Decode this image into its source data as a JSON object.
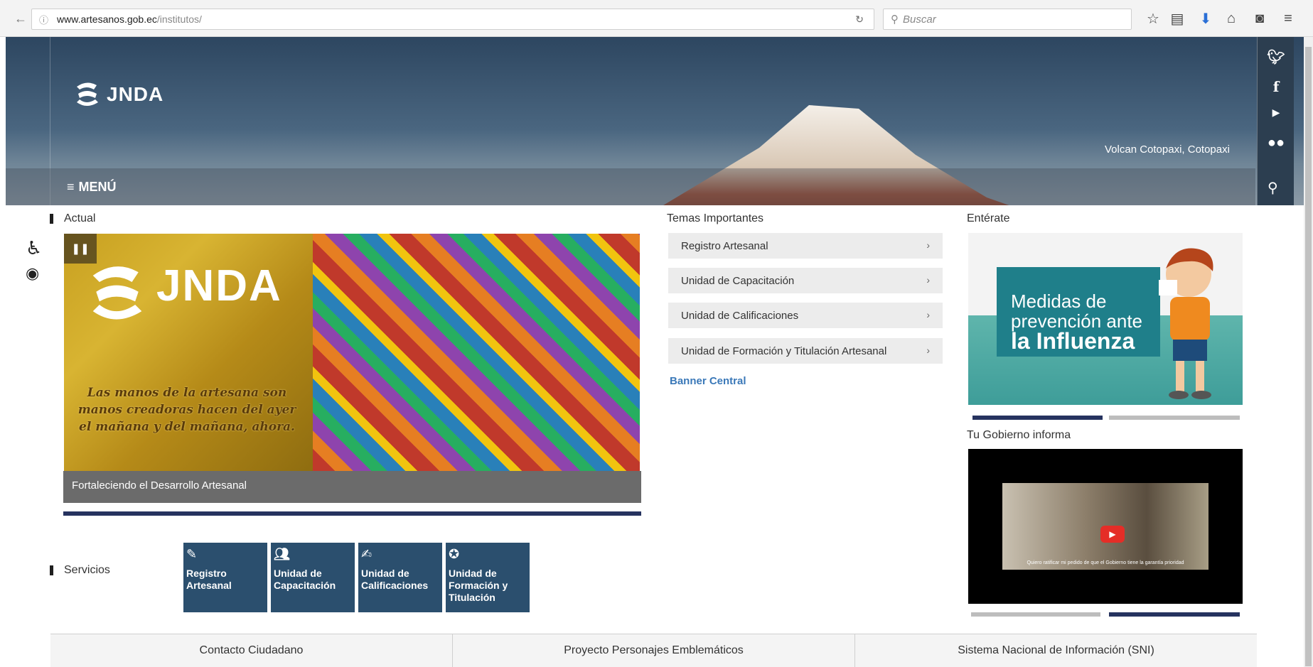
{
  "browser": {
    "url_domain": "www.artesanos.gob.ec",
    "url_path": "/institutos/",
    "search_placeholder": "Buscar"
  },
  "header": {
    "logo_text": "JNDA",
    "photo_caption": "Volcan Cotopaxi, Cotopaxi",
    "menu_label": "MENÚ"
  },
  "social": [
    "twitter-icon",
    "facebook-icon",
    "youtube-icon",
    "flickr-icon"
  ],
  "actual": {
    "title": "Actual",
    "slide_logo": "JNDA",
    "slide_motto": "Las manos de la artesana son manos creadoras hacen del ayer el mañana y del mañana, ahora.",
    "caption": "Fortaleciendo el Desarrollo Artesanal"
  },
  "servicios": {
    "title": "Servicios",
    "items": [
      {
        "label": "Registro Artesanal",
        "icon": "pencil-icon"
      },
      {
        "label": "Unidad de Capacitación",
        "icon": "users-icon"
      },
      {
        "label": "Unidad de Calificaciones",
        "icon": "edit-icon"
      },
      {
        "label": "Unidad de Formación y Titulación",
        "icon": "award-icon"
      }
    ]
  },
  "temas": {
    "title": "Temas Importantes",
    "items": [
      "Registro Artesanal",
      "Unidad de Capacitación",
      "Unidad de Calificaciones",
      "Unidad de Formación y Titulación Artesanal"
    ],
    "banner_link": "Banner Central"
  },
  "enterate": {
    "title": "Entérate",
    "line1": "Medidas de",
    "line2": "prevención ante",
    "line3": "la Influenza"
  },
  "gobierno": {
    "title": "Tu Gobierno informa",
    "video_subtitle": "Quiero ratificar mi pedido de que el Gobierno tiene la garantía prioridad"
  },
  "footer": [
    "Contacto Ciudadano",
    "Proyecto Personajes Emblemáticos",
    "Sistema Nacional de Información (SNI)"
  ],
  "colors": {
    "accent_navy": "#26335f",
    "tile_blue": "#2b4f6e",
    "link_blue": "#3a78b8"
  }
}
